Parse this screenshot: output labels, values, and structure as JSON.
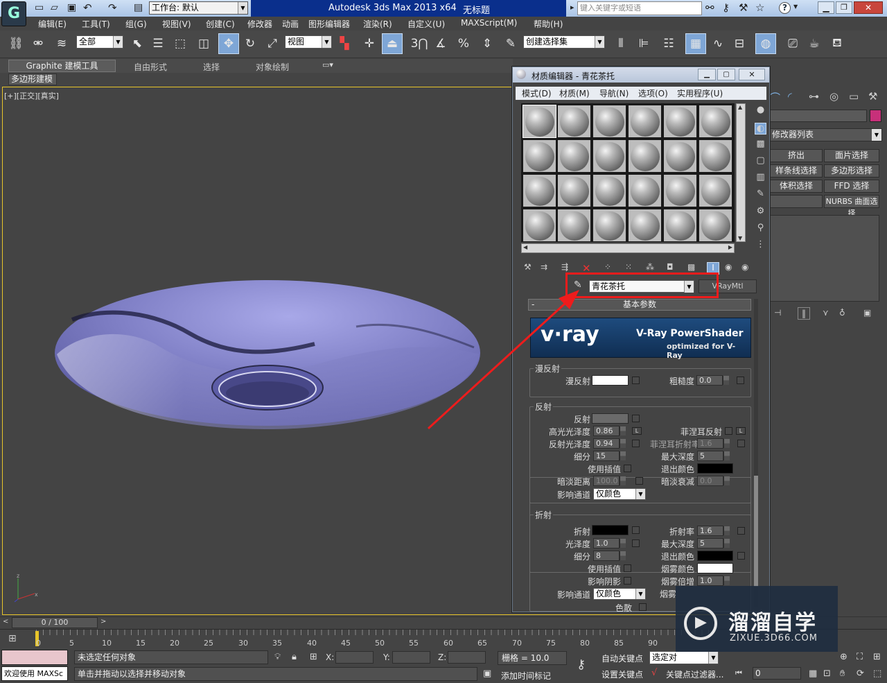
{
  "titlebar": {
    "workspace_label": "工作台: 默认",
    "app_title": "Autodesk 3ds Max  2013 x64",
    "file_name": "无标题",
    "search_placeholder": "键入关键字或短语"
  },
  "menubar": [
    "编辑(E)",
    "工具(T)",
    "组(G)",
    "视图(V)",
    "创建(C)",
    "修改器",
    "动画",
    "图形编辑器",
    "渲染(R)",
    "自定义(U)",
    "MAXScript(M)",
    "帮助(H)"
  ],
  "toolbar": {
    "filter_value": "全部",
    "refcoord_value": "视图",
    "snap_label": "3",
    "named_selection_placeholder": "创建选择集"
  },
  "ribbon": {
    "tabs": [
      "Graphite 建模工具",
      "自由形式",
      "选择",
      "对象绘制"
    ],
    "sub_label": "多边形建模"
  },
  "viewport": {
    "label": "[+][正交][真实]"
  },
  "command_panel": {
    "modifier_list": "修改器列表",
    "buttons": [
      "挤出",
      "面片选择",
      "样条线选择",
      "多边形选择",
      "体积选择",
      "FFD 选择",
      "",
      "NURBS 曲面选择"
    ]
  },
  "mat_editor": {
    "title": "材质编辑器 - 青花茶托",
    "menu": [
      "模式(D)",
      "材质(M)",
      "导航(N)",
      "选项(O)",
      "实用程序(U)"
    ],
    "material_name": "青花茶托",
    "material_type": "VRayMtl",
    "rollout_title": "基本参数",
    "banner_brand": "v·ray",
    "banner_title": "V-Ray PowerShader",
    "banner_sub": "optimized for V-Ray",
    "diffuse_group": "漫反射",
    "diffuse_label": "漫反射",
    "roughness_label": "粗糙度",
    "roughness_value": "0.0",
    "reflect_group": "反射",
    "reflect_label": "反射",
    "hilight_gloss_label": "高光光泽度",
    "hilight_gloss_value": "0.86",
    "l_button": "L",
    "fresnel_label": "菲涅耳反射",
    "refl_gloss_label": "反射光泽度",
    "refl_gloss_value": "0.94",
    "fresnel_ior_label": "菲涅耳折射率",
    "fresnel_ior_value": "1.6",
    "subdivs_label": "细分",
    "refl_subdivs_value": "15",
    "max_depth_label": "最大深度",
    "refl_max_depth_value": "5",
    "use_interp_label": "使用插值",
    "exit_color_label": "退出颜色",
    "dim_dist_label": "暗淡距离",
    "dim_dist_value": "100.0",
    "dim_falloff_label": "暗淡衰减",
    "dim_falloff_value": "0.0",
    "affect_channels_label": "影响通道",
    "affect_channels_value": "仅颜色",
    "refract_group": "折射",
    "refract_label": "折射",
    "ior_label": "折射率",
    "ior_value": "1.6",
    "gloss_label": "光泽度",
    "gloss_value": "1.0",
    "refr_max_depth_value": "5",
    "refr_subdivs_value": "8",
    "fog_color_label": "烟雾颜色",
    "affect_shadows_label": "影响阴影",
    "fog_mult_label": "烟雾倍增",
    "fog_mult_value": "1.0",
    "fog_bias_label": "烟雾",
    "dispersion_label": "色散"
  },
  "timeline": {
    "frame_label": "0 / 100",
    "ticks": [
      "0",
      "5",
      "10",
      "15",
      "20",
      "25",
      "30",
      "35",
      "40",
      "45",
      "50",
      "55",
      "60",
      "65",
      "70",
      "75",
      "80",
      "85",
      "90"
    ]
  },
  "status": {
    "welcome": "欢迎使用 MAXSc",
    "selection": "未选定任何对象",
    "prompt": "单击并拖动以选择并移动对象",
    "x_label": "X:",
    "y_label": "Y:",
    "z_label": "Z:",
    "grid": "栅格 = 10.0",
    "add_time_tag": "添加时间标记",
    "auto_key": "自动关键点",
    "set_key": "设置关键点",
    "selected_dropdown": "选定对",
    "key_filters": "关键点过滤器...",
    "frame_value": "0"
  },
  "watermark": {
    "title": "溜溜自学",
    "url": "ZIXUE.3D66.COM"
  },
  "colors": {
    "accent": "#7ea6d6",
    "annotation": "#ee1c1c",
    "saucer": "#8a8ad0"
  }
}
